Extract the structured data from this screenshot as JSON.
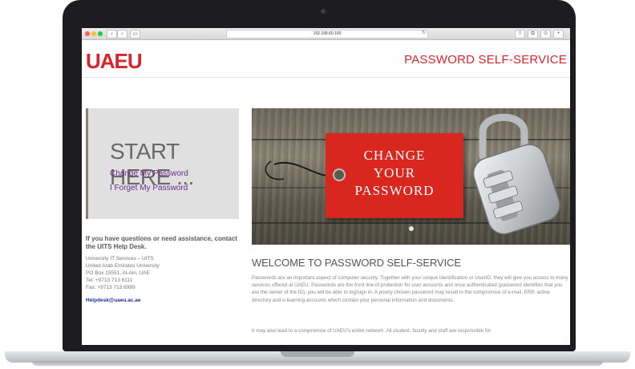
{
  "browser": {
    "url": "192.168.60.100"
  },
  "header": {
    "logo": "UAEU",
    "title": "PASSWORD SELF-SERVICE"
  },
  "start_panel": {
    "title": "START HERE ...",
    "links": [
      "Change My Password",
      "I Forget My Password"
    ]
  },
  "help": {
    "intro": "If you have questions or need assistance, contact the UITS Help Desk.",
    "lines": [
      "University IT Services – UITS",
      "United Arab Emirates University",
      "PO Box 15551, Al-Ain, UAE",
      "Tel: +9713 713 6111",
      "Fax: +9713 713 6999"
    ],
    "email": "Helpdesk@uaeu.ac.ae"
  },
  "hero": {
    "tag_lines": [
      "CHANGE",
      "YOUR",
      "PASSWORD"
    ]
  },
  "welcome": {
    "title": "WELCOME TO PASSWORD SELF-SERVICE",
    "para1": "Passwords are an important aspect of computer security. Together with your unique Identification or UserID, they will give you access to many services offered at UAEU. Passwords are the front line of protection for user accounts and once authenticated (password identifies that you are the owner of the ID), you will be able to log/sign in. A poorly chosen password may result in the compromise of e-mail, ERP, active directory and e-learning accounts which contain your personal information and documents.",
    "para2": "It may also lead to a compromise of UAEU's entire network. All student, faculty and staff are responsible for"
  },
  "colors": {
    "brand_red": "#d8242d",
    "link_purple": "#6a2c8a",
    "tag_red": "#d9271f"
  }
}
